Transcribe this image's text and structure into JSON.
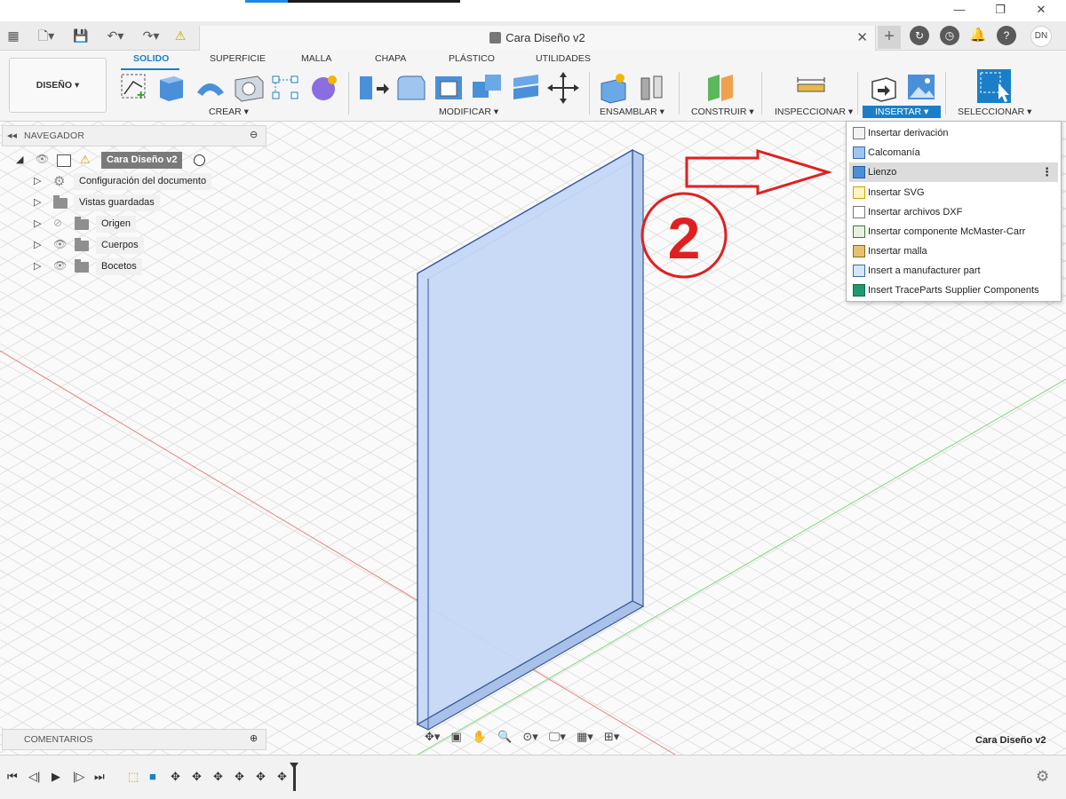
{
  "document": {
    "title": "Cara Diseño v2",
    "corner_name": "Cara Diseño v2",
    "user_initials": "DN"
  },
  "window": {
    "minimize": "—",
    "restore": "❐",
    "close": "✕"
  },
  "toolbar": {
    "workspace": "DISEÑO ▾",
    "tabs": [
      "SOLIDO",
      "SUPERFICIE",
      "MALLA",
      "CHAPA",
      "PLÁSTICO",
      "UTILIDADES"
    ],
    "groups": [
      "CREAR ▾",
      "MODIFICAR ▾",
      "ENSAMBLAR ▾",
      "CONSTRUIR ▾",
      "INSPECCIONAR ▾",
      "INSERTAR ▾",
      "SELECCIONAR ▾"
    ]
  },
  "navigator": {
    "header": "NAVEGADOR",
    "root": "Cara Diseño v2",
    "items": [
      "Configuración del documento",
      "Vistas guardadas",
      "Origen",
      "Cuerpos",
      "Bocetos"
    ]
  },
  "insert_menu": {
    "items": [
      "Insertar derivación",
      "Calcomanía",
      "Lienzo",
      "Insertar SVG",
      "Insertar archivos DXF",
      "Insertar componente McMaster-Carr",
      "Insertar malla",
      "Insert a manufacturer part",
      "Insert TraceParts Supplier Components"
    ],
    "highlighted": "Lienzo"
  },
  "annotation": {
    "step_number": "2",
    "color": "#e02020"
  },
  "comments": {
    "header": "COMENTARIOS"
  },
  "colors": {
    "accent": "#1a7fc8",
    "body_fill": "#c5d8f5",
    "body_edge": "#3a5a9a"
  }
}
